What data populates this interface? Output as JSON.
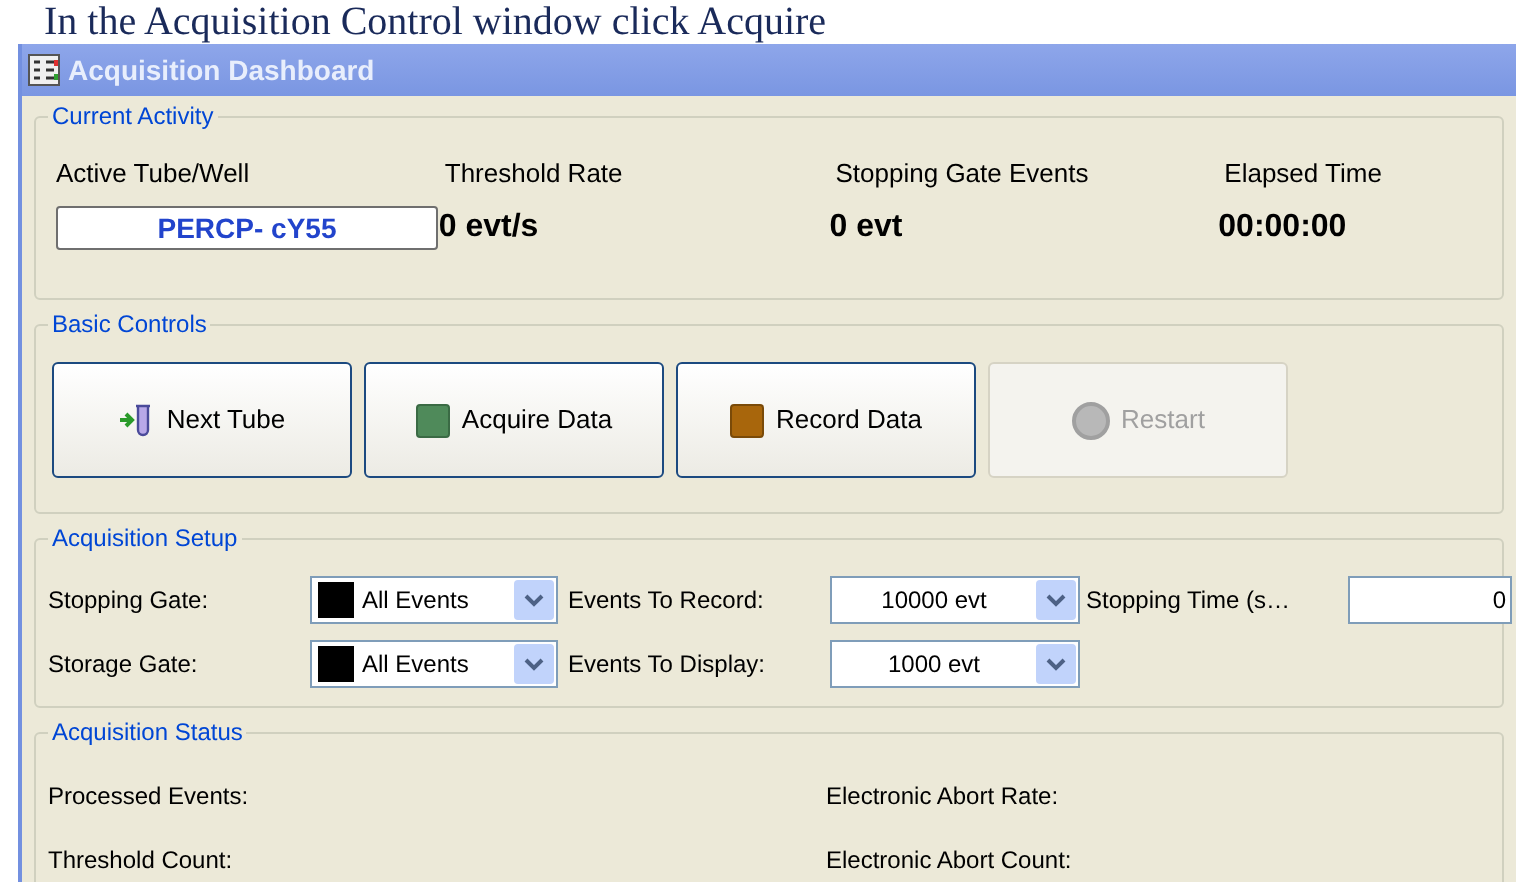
{
  "caption": "In the Acquisition Control window click Acquire",
  "window": {
    "title": "Acquisition Dashboard"
  },
  "current_activity": {
    "title": "Current Activity",
    "fields": [
      {
        "label": "Active Tube/Well",
        "value": "PERCP- cY55",
        "kind": "box"
      },
      {
        "label": "Threshold Rate",
        "value": "0 evt/s",
        "kind": "plain"
      },
      {
        "label": "Stopping Gate Events",
        "value": "0 evt",
        "kind": "plain"
      },
      {
        "label": "Elapsed Time",
        "value": "00:00:00",
        "kind": "plain"
      }
    ]
  },
  "basic_controls": {
    "title": "Basic Controls",
    "buttons": [
      {
        "label": "Next Tube",
        "kind": "tube",
        "disabled": false
      },
      {
        "label": "Acquire Data",
        "kind": "acquire",
        "disabled": false
      },
      {
        "label": "Record Data",
        "kind": "record",
        "disabled": false
      },
      {
        "label": "Restart",
        "kind": "restart",
        "disabled": true
      }
    ]
  },
  "acquisition_setup": {
    "title": "Acquisition Setup",
    "rows": [
      [
        {
          "label": "Stopping Gate:",
          "value": "All Events",
          "kind": "gate"
        },
        {
          "label": "Events To Record:",
          "value": "10000 evt",
          "kind": "count"
        },
        {
          "label": "Stopping Time (s…",
          "value": "0",
          "kind": "field"
        }
      ],
      [
        {
          "label": "Storage Gate:",
          "value": "All Events",
          "kind": "gate"
        },
        {
          "label": "Events To Display:",
          "value": "1000 evt",
          "kind": "count"
        }
      ]
    ]
  },
  "acquisition_status": {
    "title": "Acquisition Status",
    "items": [
      {
        "label": "Processed Events:"
      },
      {
        "label": "Electronic Abort Rate:"
      },
      {
        "label": "Threshold Count:"
      },
      {
        "label": "Electronic Abort Count:"
      }
    ]
  }
}
